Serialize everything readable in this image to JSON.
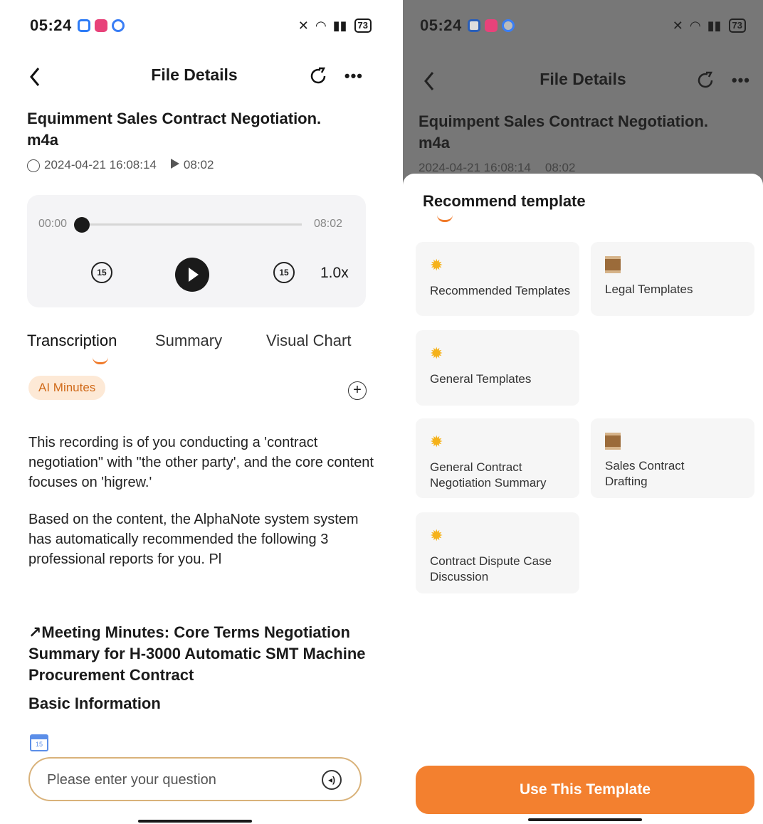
{
  "status_bar": {
    "time": "05:24",
    "battery": "73"
  },
  "header": {
    "title": "File Details"
  },
  "file": {
    "name": "Equimment Sales Contract Negotiation.\nm4a",
    "date": "2024-04-21 16:08:14",
    "duration": "08:02"
  },
  "player": {
    "current": "00:00",
    "total": "08:02",
    "skip_back": "15",
    "skip_forward": "15",
    "speed": "1.0x",
    "progress": 0.0
  },
  "tabs": [
    "Transcription",
    "Summary",
    "Visual Chart"
  ],
  "chip": "AI Minutes",
  "content": {
    "para1": "This recording is of you conducting a 'contract negotiation\" with \"the other party', and the core content focuses on 'higrew.'",
    "para2": "Based on the content, the AlphaNote system system has automatically recommended the following 3 professional reports for you. Pl",
    "minutes_title": "↗Meeting Minutes: Core Terms Negotiation Summary for H-3000 Automatic SMT Machine Procurement Contract",
    "basic_info": "Basic Information",
    "calendar_day": "15"
  },
  "question_input": {
    "placeholder": "Please enter your question"
  },
  "right": {
    "file_name": "Equimpent Sales Contract Negotiation.\nm4a",
    "file_date": "2024-04-21 16:08:14",
    "file_duration": "08:02",
    "sheet_title": "Recommend template",
    "templates": [
      {
        "label": "Recommended Templates",
        "icon": "star-icon"
      },
      {
        "label": "Legal Templates",
        "icon": "book-icon"
      },
      {
        "label": "General Templates",
        "icon": "star-icon"
      },
      {
        "label": "General Contract Negotiation Summary",
        "icon": "star-icon"
      },
      {
        "label": "Sales Contract Drafting",
        "icon": "book-icon"
      },
      {
        "label": "Contract Dispute Case Discussion",
        "icon": "star-icon"
      }
    ],
    "use_button": "Use This Template"
  },
  "colors": {
    "accent": "#f3802f",
    "chip_bg": "#fde9d6",
    "chip_text": "#d06a1a"
  }
}
